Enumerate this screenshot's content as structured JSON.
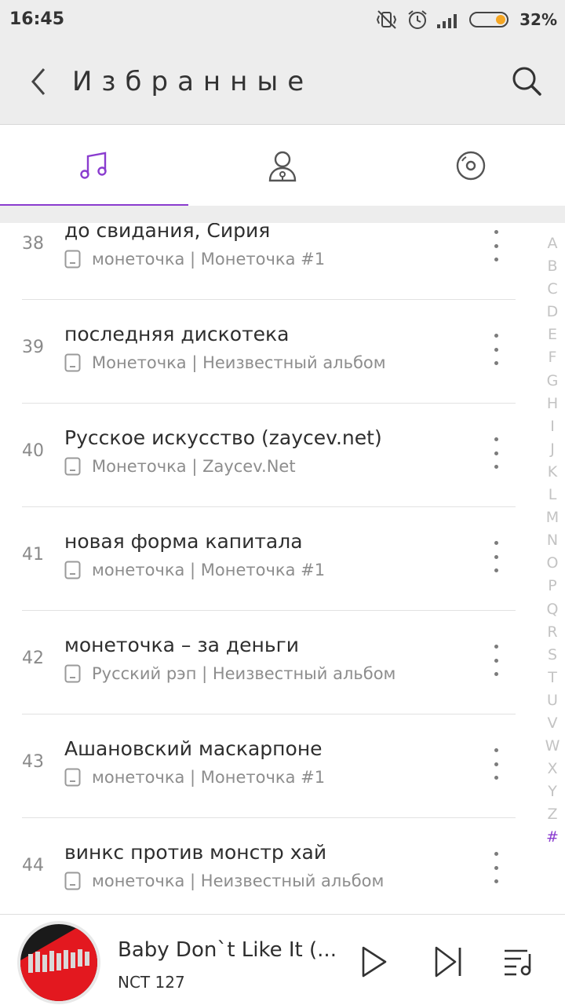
{
  "status": {
    "time": "16:45",
    "battery": "32%"
  },
  "header": {
    "title": "Избранные"
  },
  "tabs": [
    {
      "name": "songs",
      "icon": "music-note-icon",
      "active": true
    },
    {
      "name": "artists",
      "icon": "artist-icon",
      "active": false
    },
    {
      "name": "albums",
      "icon": "disc-icon",
      "active": false
    }
  ],
  "songs": [
    {
      "num": "38",
      "title": "до свидания, Сирия",
      "meta": "монеточка | Монеточка #1"
    },
    {
      "num": "39",
      "title": "последняя дискотека",
      "meta": "Монеточка | Неизвестный альбом"
    },
    {
      "num": "40",
      "title": "Русское искусство (zaycev.net)",
      "meta": "Монеточка | Zaycev.Net"
    },
    {
      "num": "41",
      "title": "новая форма капитала",
      "meta": "монеточка | Монеточка #1"
    },
    {
      "num": "42",
      "title": "монеточка – за деньги",
      "meta": "Русский рэп | Неизвестный альбом"
    },
    {
      "num": "43",
      "title": "Ашановский маскарпоне",
      "meta": "монеточка | Монеточка #1"
    },
    {
      "num": "44",
      "title": "винкс против монстр хай",
      "meta": "монеточка | Неизвестный альбом"
    }
  ],
  "alphabet": [
    "A",
    "B",
    "C",
    "D",
    "E",
    "F",
    "G",
    "H",
    "I",
    "J",
    "K",
    "L",
    "M",
    "N",
    "O",
    "P",
    "Q",
    "R",
    "S",
    "T",
    "U",
    "V",
    "W",
    "X",
    "Y",
    "Z",
    "#"
  ],
  "alphabet_active": "#",
  "player": {
    "title": "Baby Don`t Like It (...",
    "artist": "NCT 127"
  },
  "colors": {
    "accent": "#8a3ccf",
    "battery": "#f5a623"
  }
}
